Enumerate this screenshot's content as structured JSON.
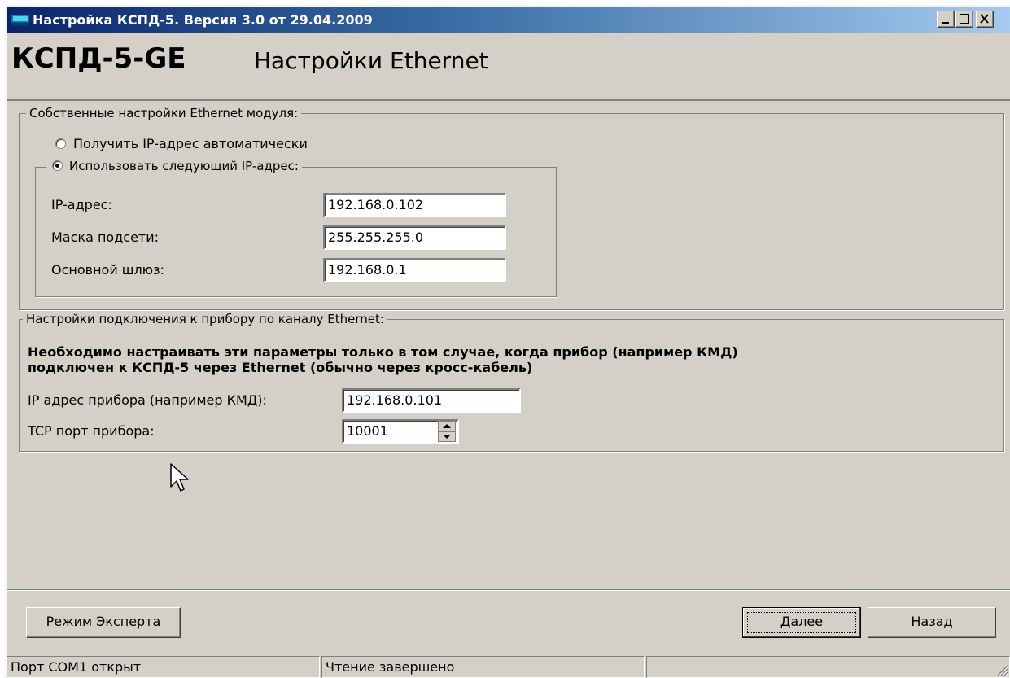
{
  "window": {
    "title": "Настройка КСПД-5. Версия 3.0 от 29.04.2009"
  },
  "header": {
    "model": "КСПД-5-GE",
    "page_title": "Настройки Ethernet"
  },
  "own_settings": {
    "legend": "Собственные настройки Ethernet модуля:",
    "radio_auto_label": "Получить IP-адрес автоматически",
    "radio_manual_label": "Использовать следующий IP-адрес:",
    "selected": "manual",
    "ip_label": "IP-адрес:",
    "ip_value": "192.168.0.102",
    "mask_label": "Маска подсети:",
    "mask_value": "255.255.255.0",
    "gateway_label": "Основной шлюз:",
    "gateway_value": "192.168.0.1"
  },
  "device_settings": {
    "legend": "Настройки подключения к прибору по каналу Ethernet:",
    "note_line1": "Необходимо настраивать эти параметры только в том случае, когда прибор (например КМД)",
    "note_line2": "подключен к КСПД-5 через Ethernet (обычно через кросс-кабель)",
    "ip_label": "IP адрес прибора (например КМД):",
    "ip_value": "192.168.0.101",
    "port_label": "TCP порт прибора:",
    "port_value": "10001"
  },
  "buttons": {
    "expert": "Режим Эксперта",
    "next": "Далее",
    "back": "Назад"
  },
  "status_bar": {
    "port_status": "Порт COM1 открыт",
    "read_status": "Чтение завершено",
    "extra": ""
  },
  "icons": {
    "app": "app-monitor-icon",
    "minimize": "minimize-icon",
    "maximize": "maximize-icon",
    "close": "close-icon",
    "cursor": "mouse-cursor-icon",
    "spin": "spin-up-down-icon",
    "grip": "resize-grip-icon"
  },
  "colors": {
    "titlebar_start": "#0a246a",
    "titlebar_end": "#a6caf0",
    "face": "#d4d0c8"
  }
}
